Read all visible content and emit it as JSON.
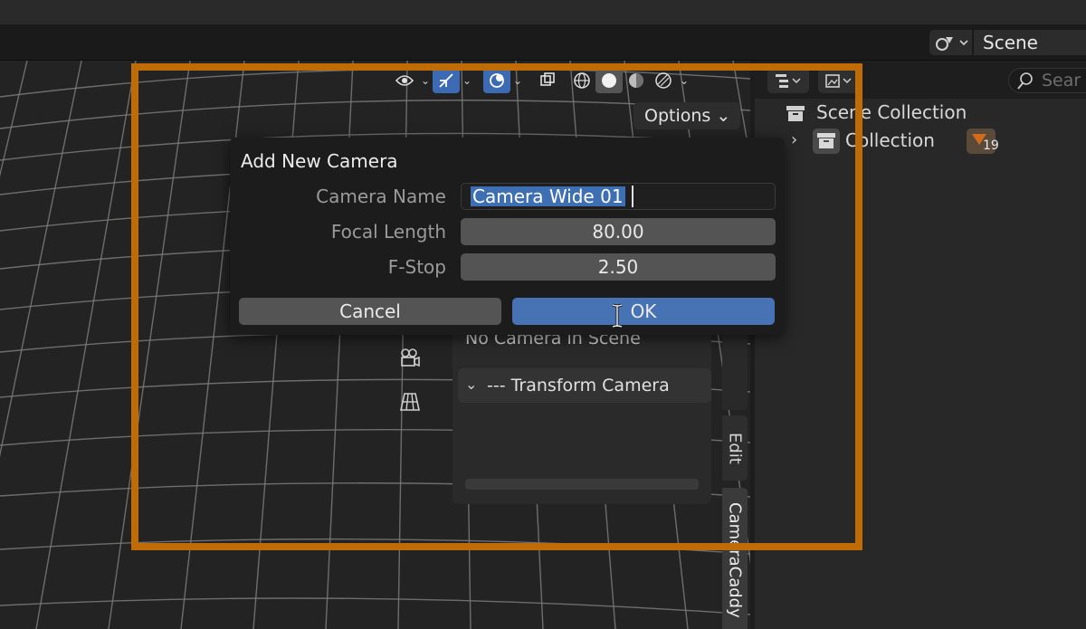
{
  "header": {
    "scene_label": "Scene"
  },
  "viewport": {
    "options_label": "Options ⌄",
    "tabs": {
      "edit": "Edit",
      "addon": "CameraCaddy"
    },
    "panel": {
      "no_camera": "No Camera in Scene",
      "section": "--- Transform Camera"
    }
  },
  "outliner": {
    "search_placeholder": "Sear",
    "scene_collection": "Scene Collection",
    "collection": "Collection",
    "badge_count": "19"
  },
  "dialog": {
    "title": "Add New Camera",
    "fields": {
      "camera_name_label": "Camera Name",
      "camera_name_value": "Camera Wide 01",
      "focal_length_label": "Focal Length",
      "focal_length_value": "80.00",
      "fstop_label": "F-Stop",
      "fstop_value": "2.50"
    },
    "cancel_label": "Cancel",
    "ok_label": "OK"
  },
  "colors": {
    "accent": "#4772b3",
    "highlight_frame": "#bf6b06",
    "badge": "#d36a1c"
  }
}
